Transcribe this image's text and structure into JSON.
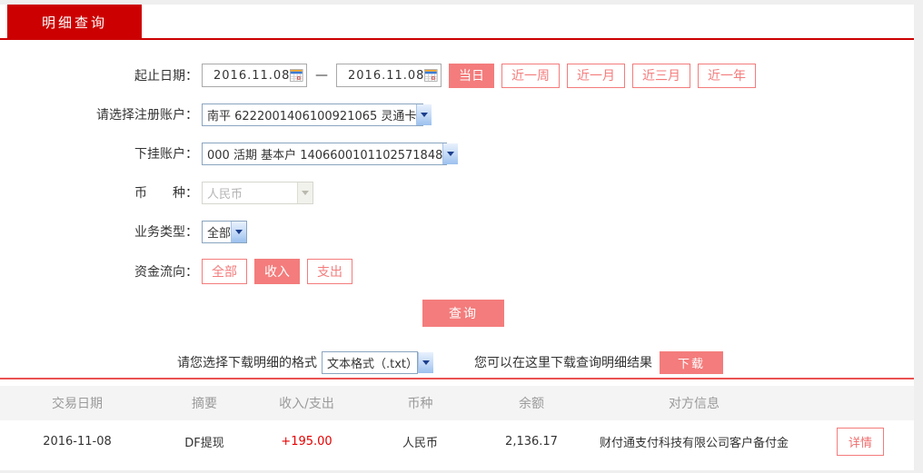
{
  "tab": {
    "label": "明细查询"
  },
  "form": {
    "date_range": {
      "label": "起止日期：",
      "start": "2016.11.08",
      "end": "2016.11.08",
      "separator": "—",
      "quick_buttons": [
        {
          "label": "当日",
          "active": true
        },
        {
          "label": "近一周",
          "active": false
        },
        {
          "label": "近一月",
          "active": false
        },
        {
          "label": "近三月",
          "active": false
        },
        {
          "label": "近一年",
          "active": false
        }
      ]
    },
    "register_account": {
      "label": "请选择注册账户：",
      "value": "南平 6222001406100921065 灵通卡"
    },
    "sub_account": {
      "label": "下挂账户：",
      "value": "000 活期 基本户 1406600101102571848"
    },
    "currency": {
      "label": "币　　种：",
      "value": "人民币",
      "disabled": true
    },
    "business_type": {
      "label": "业务类型：",
      "value": "全部"
    },
    "fund_flow": {
      "label": "资金流向：",
      "options": [
        {
          "label": "全部",
          "active": false
        },
        {
          "label": "收入",
          "active": true
        },
        {
          "label": "支出",
          "active": false
        }
      ]
    },
    "query_button": "查询"
  },
  "download": {
    "format_label": "请您选择下载明细的格式",
    "format_value": "文本格式（.txt）",
    "hint": "您可以在这里下载查询明细结果",
    "button": "下载"
  },
  "table": {
    "headers": [
      "交易日期",
      "摘要",
      "收入/支出",
      "币种",
      "余额",
      "对方信息"
    ],
    "rows": [
      {
        "date": "2016-11-08",
        "summary": "DF提现",
        "amount": "+195.00",
        "currency": "人民币",
        "balance": "2,136.17",
        "counterparty": "财付通支付科技有限公司客户备付金",
        "detail_button": "详情"
      }
    ]
  },
  "colors": {
    "tab_red": "#cc0001",
    "salmon": "#f47c7c",
    "amount_red": "#e60000",
    "divider_red": "#e95252",
    "header_gray": "#f4f4f4"
  }
}
